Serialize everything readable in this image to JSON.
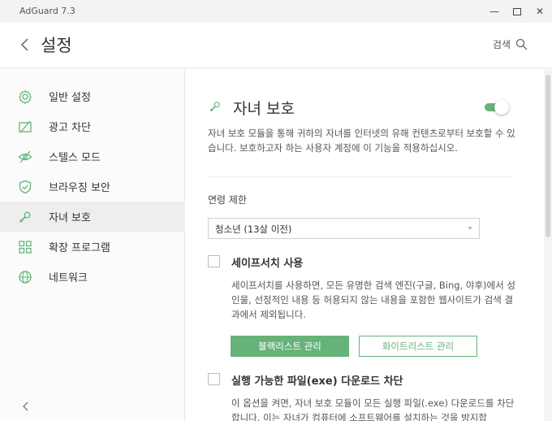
{
  "window": {
    "title": "AdGuard 7.3"
  },
  "header": {
    "title": "설정",
    "search_label": "검색"
  },
  "sidebar": {
    "items": [
      {
        "label": "일반 설정",
        "icon": "gear-icon"
      },
      {
        "label": "광고 차단",
        "icon": "ad-block-icon"
      },
      {
        "label": "스텔스 모드",
        "icon": "eye-crossed-icon"
      },
      {
        "label": "브라우징 보안",
        "icon": "shield-check-icon"
      },
      {
        "label": "자녀 보호",
        "icon": "rattle-icon",
        "active": true
      },
      {
        "label": "확장 프로그램",
        "icon": "extensions-icon"
      },
      {
        "label": "네트워크",
        "icon": "globe-icon"
      }
    ]
  },
  "main": {
    "title": "자녀 보호",
    "enabled": true,
    "description": "자녀 보호 모듈을 통해 귀하의 자녀를 인터넷의 유해 컨텐츠로부터 보호할 수 있습니다. 보호하고자 하는 사용자 계정에 이 기능을 적용하십시오.",
    "age_label": "연령 제한",
    "age_value": "청소년 (13살 이전)",
    "safesearch": {
      "title": "세이프서치 사용",
      "description": "세이프서치를 사용하면, 모든 유명한 검색 엔진(구글, Bing, 야후)에서 성인물, 선정적인 내용 등 허용되지 않는 내용을 포함한 웹사이트가 검색 결과에서 제외됩니다.",
      "checked": false
    },
    "blacklist_button": "블랙리스트 관리",
    "whitelist_button": "화이트리스트 관리",
    "exe_block": {
      "title": "실행 가능한 파일(exe) 다운로드 차단",
      "description": "이 옵션을 켜면, 자녀 보호 모듈이 모든 실행 파일(.exe) 다운로드를 차단합니다. 이는 자녀가 컴퓨터에 소프트웨어를 설치하는 것을 방지합",
      "checked": false
    }
  },
  "colors": {
    "accent": "#67b279",
    "sidebar_bg": "#fbfbfb",
    "active_bg": "#eeeeee"
  }
}
